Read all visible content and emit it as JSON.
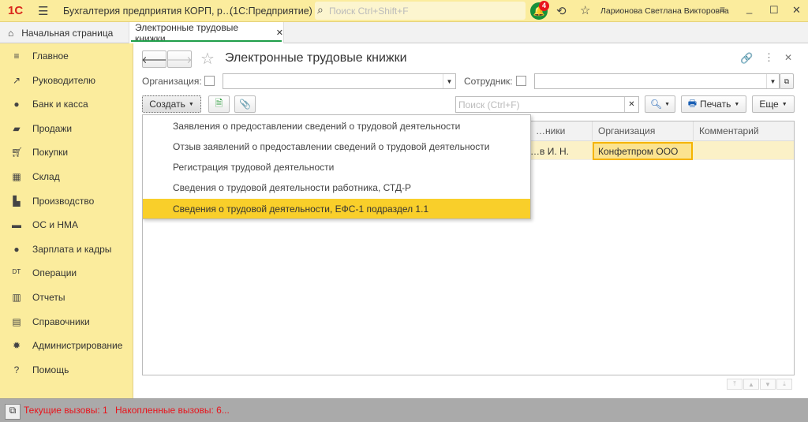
{
  "titlebar": {
    "app_title": "Бухгалтерия предприятия КОРП, р…",
    "platform": "(1С:Предприятие)",
    "search_placeholder": "Поиск Ctrl+Shift+F",
    "notifications_count": "4",
    "user": "Ларионова Светлана Викторовна"
  },
  "tabs": [
    {
      "label": "Начальная страница"
    },
    {
      "label": "Электронные трудовые книжки",
      "active": true
    }
  ],
  "sidebar": {
    "items": [
      {
        "label": "Главное",
        "icon": "menu-icon"
      },
      {
        "label": "Руководителю",
        "icon": "chart-icon"
      },
      {
        "label": "Банк и касса",
        "icon": "coin-icon"
      },
      {
        "label": "Продажи",
        "icon": "bag-icon"
      },
      {
        "label": "Покупки",
        "icon": "cart-icon"
      },
      {
        "label": "Склад",
        "icon": "warehouse-icon"
      },
      {
        "label": "Производство",
        "icon": "factory-icon"
      },
      {
        "label": "ОС и НМА",
        "icon": "truck-icon"
      },
      {
        "label": "Зарплата и кадры",
        "icon": "person-icon"
      },
      {
        "label": "Операции",
        "icon": "dt-kt-icon"
      },
      {
        "label": "Отчеты",
        "icon": "bar-chart-icon"
      },
      {
        "label": "Справочники",
        "icon": "books-icon"
      },
      {
        "label": "Администрирование",
        "icon": "gear-icon"
      },
      {
        "label": "Помощь",
        "icon": "help-icon"
      }
    ]
  },
  "form": {
    "title": "Электронные трудовые книжки",
    "org_label": "Организация:",
    "org_value": "",
    "employee_label": "Сотрудник:",
    "employee_value": "",
    "create_label": "Создать",
    "search_placeholder": "Поиск (Ctrl+F)",
    "print_label": "Печать",
    "more_label": "Еще"
  },
  "create_menu": {
    "items": [
      "Заявления о предоставлении сведений о трудовой деятельности",
      "Отзыв заявлений о предоставлении сведений о трудовой деятельности",
      "Регистрация трудовой деятельности",
      "Сведения о трудовой деятельности работника, СТД-Р",
      "Сведения о трудовой деятельности, ЕФС-1 подраздел 1.1"
    ],
    "highlighted": 4
  },
  "table": {
    "columns": [
      "…ники",
      "Организация",
      "Комментарий"
    ],
    "rows": [
      {
        "employees": "…в И. Н.",
        "org": "Конфетпром ООО",
        "comment": ""
      }
    ]
  },
  "status": {
    "current_calls": "Текущие вызовы: 1",
    "accumulated_calls": "Накопленные вызовы: 6..."
  },
  "colors": {
    "accent": "#fbec9d",
    "highlight": "#f9cf2a",
    "status_text": "#e8141c"
  }
}
